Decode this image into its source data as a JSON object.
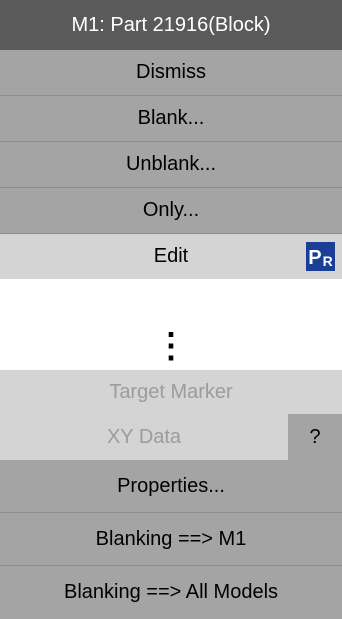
{
  "menu": {
    "title": "M1: Part 21916(Block)",
    "items_top": [
      {
        "label": "Dismiss"
      },
      {
        "label": "Blank..."
      },
      {
        "label": "Unblank..."
      },
      {
        "label": "Only..."
      }
    ],
    "edit": {
      "label": "Edit",
      "badge_p": "P",
      "badge_r": "R"
    },
    "more_glyph": "⋮",
    "target_marker": "Target Marker",
    "xy_data": "XY Data",
    "help": "?",
    "items_bottom": [
      {
        "label": "Properties..."
      },
      {
        "label": "Blanking ==> M1"
      },
      {
        "label": "Blanking ==> All Models"
      }
    ]
  }
}
